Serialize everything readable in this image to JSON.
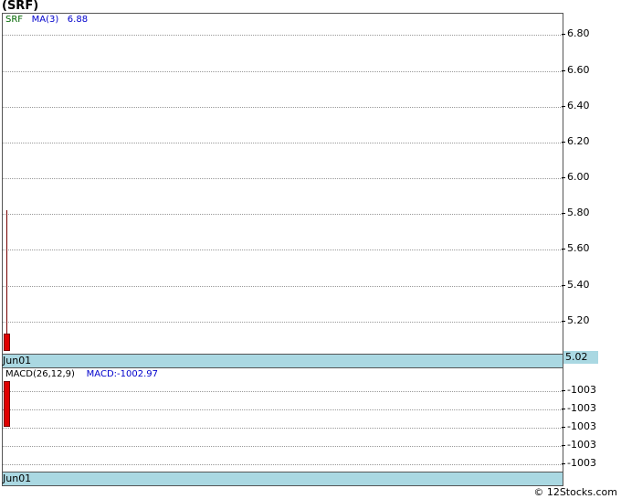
{
  "title": "(SRF)",
  "price": {
    "legend_symbol": "SRF",
    "legend_ma_label": "MA(3)",
    "legend_ma_value": "6.88",
    "date_label": "Jun01",
    "last_price": "5.02"
  },
  "macd": {
    "legend_label": "MACD(26,12,9)",
    "legend_value": "MACD:-1002.97",
    "date_label": "Jun01"
  },
  "footer": "© 12Stocks.com",
  "colors": {
    "axis_bar": "#aad8e2",
    "candle_down": "#e00000",
    "symbol": "#006600",
    "ma": "#0000cc"
  },
  "chart_data": [
    {
      "type": "candlestick",
      "title": "(SRF)",
      "categories": [
        "Jun01"
      ],
      "ylim": [
        5.02,
        6.92
      ],
      "yticks": [
        5.2,
        5.4,
        5.6,
        5.8,
        6.0,
        6.2,
        6.4,
        6.6,
        6.8
      ],
      "ytick_labels": [
        "5.20",
        "5.40",
        "5.60",
        "5.80",
        "6.00",
        "6.20",
        "6.40",
        "6.60",
        "6.80"
      ],
      "series": [
        {
          "name": "SRF",
          "ohlc": [
            [
              5.12,
              5.76,
              5.02,
              5.02
            ]
          ]
        },
        {
          "name": "MA(3)",
          "values": [
            6.88
          ]
        }
      ],
      "grid": true
    },
    {
      "type": "bar",
      "title": "MACD(26,12,9)",
      "categories": [
        "Jun01"
      ],
      "ylim": [
        -1003.06,
        -1002.86
      ],
      "ytick_labels": [
        "-1003",
        "-1003",
        "-1003",
        "-1003",
        "-1003"
      ],
      "series": [
        {
          "name": "MACD",
          "values": [
            -1002.97
          ]
        }
      ],
      "grid": true
    }
  ]
}
